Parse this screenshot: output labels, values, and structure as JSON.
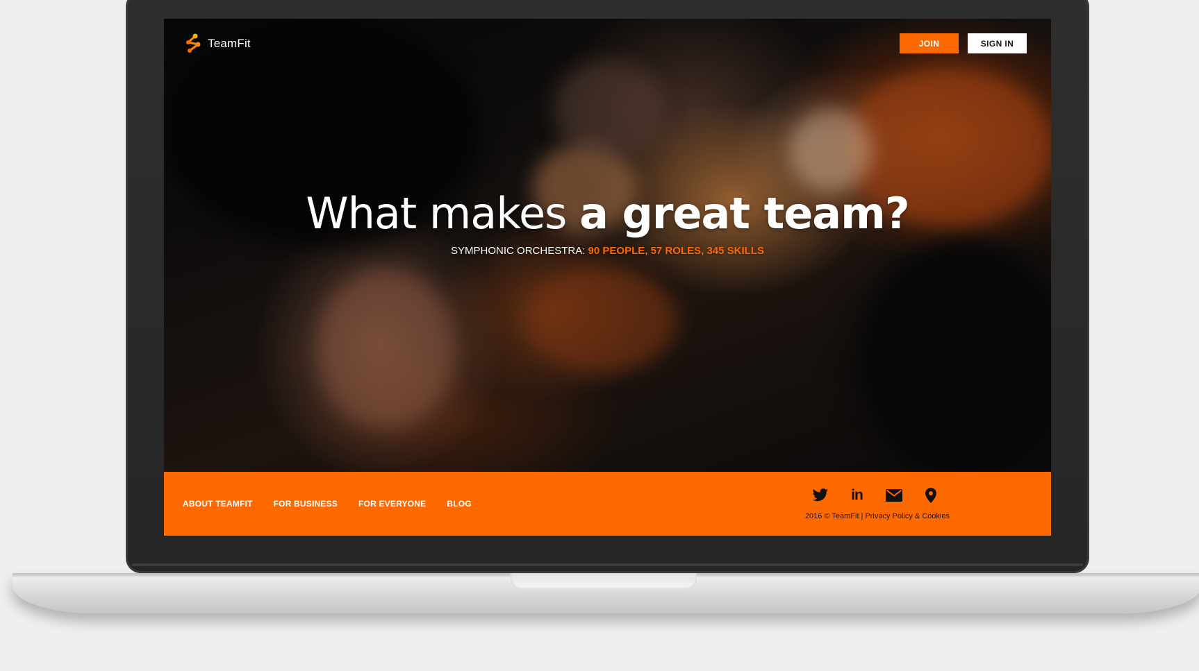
{
  "brand": {
    "name": "TeamFit",
    "accent_color": "#ff6a00"
  },
  "header": {
    "join_label": "JOIN",
    "signin_label": "SIGN IN"
  },
  "hero": {
    "headline_light": "What makes ",
    "headline_bold": "a great team?",
    "subline_prefix": "SYMPHONIC ORCHESTRA: ",
    "subline_stats": "90 PEOPLE, 57 ROLES, 345 SKILLS",
    "background": "orchestra-violinists-photo"
  },
  "footer": {
    "links": [
      {
        "label": "ABOUT TEAMFIT"
      },
      {
        "label": "FOR BUSINESS"
      },
      {
        "label": "FOR EVERYONE"
      },
      {
        "label": "BLOG"
      }
    ],
    "social_icons": [
      "twitter-icon",
      "linkedin-icon",
      "mail-icon",
      "location-pin-icon"
    ],
    "linkedin_glyph": "in",
    "copyright": "2016 © TeamFit",
    "separator": "|",
    "policy_link": "Privacy Policy & Cookies"
  }
}
